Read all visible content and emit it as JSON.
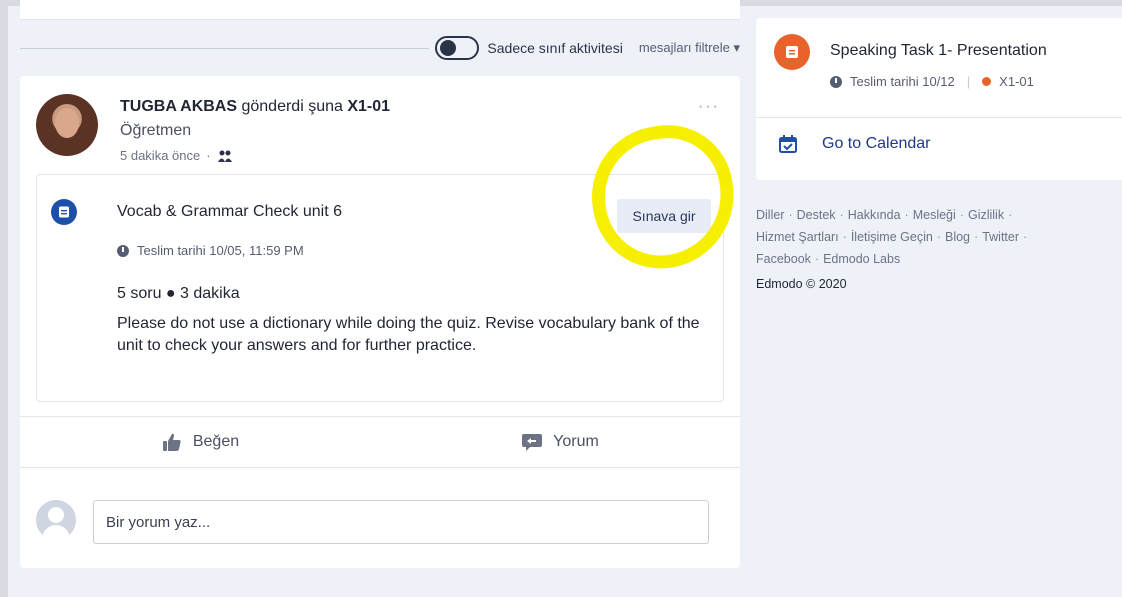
{
  "filter": {
    "toggle_label": "Sadece sınıf aktivitesi",
    "filter_menu": "mesajları filtrele"
  },
  "post": {
    "author": "TUGBA AKBAS",
    "verb": "gönderdi şuna",
    "group": "X1-01",
    "role": "Öğretmen",
    "time": "5 dakika önce",
    "more": "···",
    "quiz": {
      "title": "Vocab & Grammar Check unit 6",
      "button": "Sınava gir",
      "due": "Teslim tarihi 10/05, 11:59 PM",
      "stats": "5 soru ● 3 dakika",
      "description": "Please do not use a dictionary while doing the quiz. Revise vocabulary bank of the unit to check your answers and for further practice."
    },
    "actions": {
      "like": "Beğen",
      "comment": "Yorum"
    },
    "comment_placeholder": "Bir yorum yaz..."
  },
  "sidebar": {
    "task": {
      "title": "Speaking Task 1- Presentation",
      "due": "Teslim tarihi 10/12",
      "group": "X1-01"
    },
    "calendar_link": "Go to Calendar",
    "footer": {
      "links": [
        "Diller",
        "Destek",
        "Hakkında",
        "Mesleği",
        "Gizlilik",
        "Hizmet Şartları",
        "İletişime Geçin",
        "Blog",
        "Twitter",
        "Facebook",
        "Edmodo Labs"
      ],
      "copyright": "Edmodo © 2020"
    }
  },
  "colors": {
    "accent_blue": "#1e4fa8",
    "accent_orange": "#e8632b",
    "highlight": "#f7ef00"
  }
}
